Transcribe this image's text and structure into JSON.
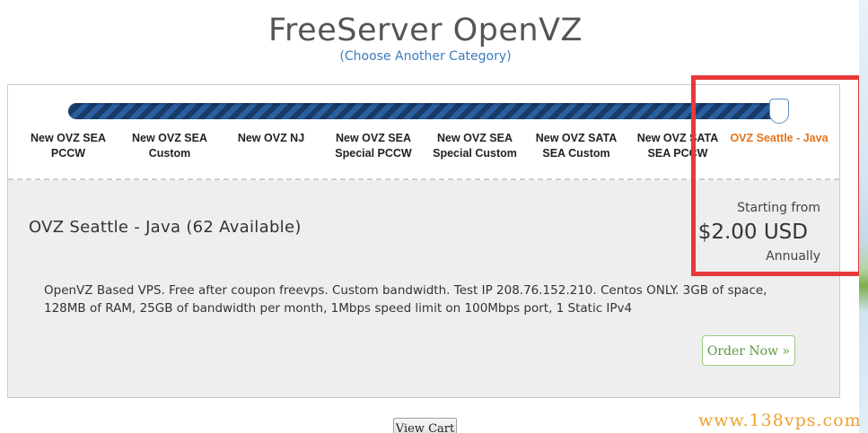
{
  "header": {
    "title": "FreeServer OpenVZ",
    "choose_link": "(Choose Another Category)"
  },
  "product_steps": [
    {
      "label": "New OVZ SEA PCCW",
      "active": false
    },
    {
      "label": "New OVZ SEA Custom",
      "active": false
    },
    {
      "label": "New OVZ NJ",
      "active": false
    },
    {
      "label": "New OVZ SEA Special PCCW",
      "active": false
    },
    {
      "label": "New OVZ SEA Special Custom",
      "active": false
    },
    {
      "label": "New OVZ SATA SEA Custom",
      "active": false
    },
    {
      "label": "New OVZ SATA SEA PCCW",
      "active": false
    },
    {
      "label": "OVZ Seattle - Java",
      "active": true
    }
  ],
  "product": {
    "name": "OVZ Seattle - Java (62 Available)",
    "starting_from": "Starting from",
    "price": "$2.00 USD",
    "billing_cycle": "Annually",
    "description": "OpenVZ Based VPS. Free after coupon freevps. Custom bandwidth. Test IP 208.76.152.210. Centos ONLY. 3GB of space, 128MB of RAM, 25GB of bandwidth per month, 1Mbps speed limit on 100Mbps port, 1 Static IPv4",
    "order_label": "Order Now »"
  },
  "footer": {
    "view_cart_label": "View Cart"
  },
  "watermark": "www.138vps.com",
  "colors": {
    "active_step": "#e5731a",
    "slider": "#1d4a82",
    "highlight": "#e8393a",
    "order_button": "#5a9a3a"
  }
}
